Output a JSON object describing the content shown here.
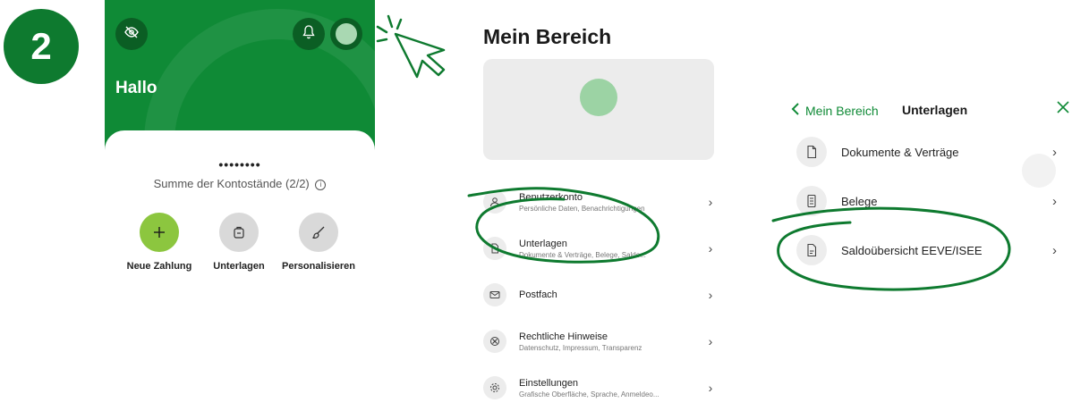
{
  "step_number": "2",
  "home": {
    "greeting": "Hallo",
    "masked_balance": "••••••••",
    "summary_label": "Summe der Kontostände (2/2)",
    "actions": [
      {
        "label": "Neue Zahlung",
        "icon": "plus-icon"
      },
      {
        "label": "Unterlagen",
        "icon": "document-bag-icon"
      },
      {
        "label": "Personalisieren",
        "icon": "brush-icon"
      }
    ],
    "colors": {
      "brand_green": "#0f8a36",
      "accent_lime": "#8cc63f",
      "dark_green": "#0b5e24"
    }
  },
  "area": {
    "title": "Mein Bereich",
    "items": [
      {
        "label": "Benutzerkonto",
        "sub": "Persönliche Daten, Benachrichtigungen",
        "icon": "user-icon"
      },
      {
        "label": "Unterlagen",
        "sub": "Dokumente & Verträge, Belege, Saldo...",
        "icon": "document-icon"
      },
      {
        "label": "Postfach",
        "sub": "",
        "icon": "mail-icon"
      },
      {
        "label": "Rechtliche Hinweise",
        "sub": "Datenschutz, Impressum, Transparenz",
        "icon": "legal-icon"
      },
      {
        "label": "Einstellungen",
        "sub": "Grafische Oberfläche, Sprache, Anmeldeo...",
        "icon": "gear-icon"
      }
    ]
  },
  "documents": {
    "back_label": "Mein Bereich",
    "title": "Unterlagen",
    "items": [
      {
        "label": "Dokumente & Verträge",
        "icon": "document-icon"
      },
      {
        "label": "Belege",
        "icon": "receipt-icon"
      },
      {
        "label": "Saldoübersicht EEVE/ISEE",
        "icon": "statement-icon"
      }
    ]
  }
}
